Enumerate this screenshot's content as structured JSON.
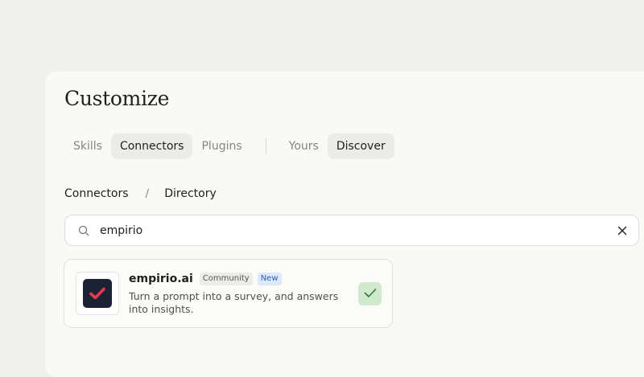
{
  "page": {
    "title": "Customize"
  },
  "tabs": {
    "section": [
      {
        "label": "Skills",
        "active": false
      },
      {
        "label": "Connectors",
        "active": true
      },
      {
        "label": "Plugins",
        "active": false
      }
    ],
    "scope": [
      {
        "label": "Yours",
        "active": false
      },
      {
        "label": "Discover",
        "active": true
      }
    ]
  },
  "breadcrumb": {
    "parent": "Connectors",
    "separator": "/",
    "current": "Directory"
  },
  "search": {
    "value": "empirio",
    "icon": "search-icon",
    "clear_icon": "close-icon"
  },
  "results": [
    {
      "name": "empirio.ai",
      "badges": [
        "Community",
        "New"
      ],
      "description": "Turn a prompt into a survey, and answers into insights.",
      "installed": true,
      "icon": "check-icon",
      "logo_color": "#1b2233",
      "logo_accent": "#e8394f"
    }
  ],
  "colors": {
    "background": "#f0f0ef",
    "panel": "#f9f9f8",
    "active_tab": "#ebebe8",
    "installed_green": "#cfeacd",
    "check_green": "#2f7a34"
  }
}
